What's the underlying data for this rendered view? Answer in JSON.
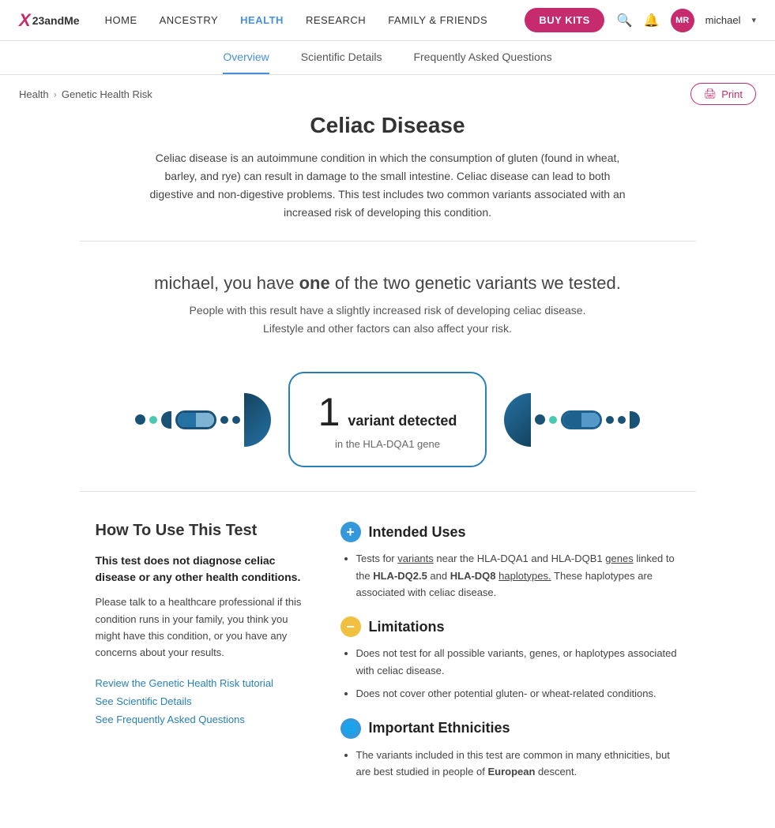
{
  "logo": {
    "symbol": "X",
    "name": "23andMe"
  },
  "nav": {
    "links": [
      {
        "label": "HOME",
        "active": false
      },
      {
        "label": "ANCESTRY",
        "active": false
      },
      {
        "label": "HEALTH",
        "active": true
      },
      {
        "label": "RESEARCH",
        "active": false
      },
      {
        "label": "FAMILY & FRIENDS",
        "active": false
      }
    ],
    "buy_kits": "BUY KITS",
    "user_initials": "MR",
    "user_name": "michael"
  },
  "sub_nav": {
    "tabs": [
      {
        "label": "Overview",
        "active": true
      },
      {
        "label": "Scientific Details",
        "active": false
      },
      {
        "label": "Frequently Asked Questions",
        "active": false
      }
    ]
  },
  "breadcrumb": {
    "parent": "Health",
    "separator": "›",
    "current": "Genetic Health Risk"
  },
  "print_button": "Print",
  "page": {
    "title": "Celiac Disease",
    "intro": "Celiac disease is an autoimmune condition in which the consumption of gluten (found in wheat, barley, and rye) can result in damage to the small intestine. Celiac disease can lead to both digestive and non-digestive problems. This test includes two common variants associated with an increased risk of developing this condition.",
    "result_statement_prefix": "michael, you have ",
    "result_bold": "one",
    "result_statement_suffix": " of the two genetic variants we tested.",
    "result_sub": "People with this result have a slightly increased risk of developing celiac disease. Lifestyle and other factors can also affect your risk.",
    "variant_number": "1",
    "variant_label": "variant detected",
    "variant_gene": "in the HLA-DQA1 gene"
  },
  "lower": {
    "left": {
      "heading": "How To Use This Test",
      "bold_text": "This test does not diagnose celiac disease or any other health conditions.",
      "para": "Please talk to a healthcare professional if this condition runs in your family, you think you might have this condition, or you have any concerns about your results.",
      "links": [
        "Review the Genetic Health Risk tutorial",
        "See Scientific Details",
        "See Frequently Asked Questions"
      ]
    },
    "right": {
      "sections": [
        {
          "icon_type": "plus",
          "heading": "Intended Uses",
          "bullets": [
            "Tests for variants near the HLA-DQA1 and HLA-DQB1 genes linked to the HLA-DQ2.5 and HLA-DQ8 haplotypes. These haplotypes are associated with celiac disease."
          ]
        },
        {
          "icon_type": "minus",
          "heading": "Limitations",
          "bullets": [
            "Does not test for all possible variants, genes, or haplotypes associated with celiac disease.",
            "Does not cover other potential gluten- or wheat-related conditions."
          ]
        },
        {
          "icon_type": "globe",
          "heading": "Important Ethnicities",
          "bullets": [
            "The variants included in this test are common in many ethnicities, but are best studied in people of European descent."
          ]
        }
      ]
    }
  }
}
